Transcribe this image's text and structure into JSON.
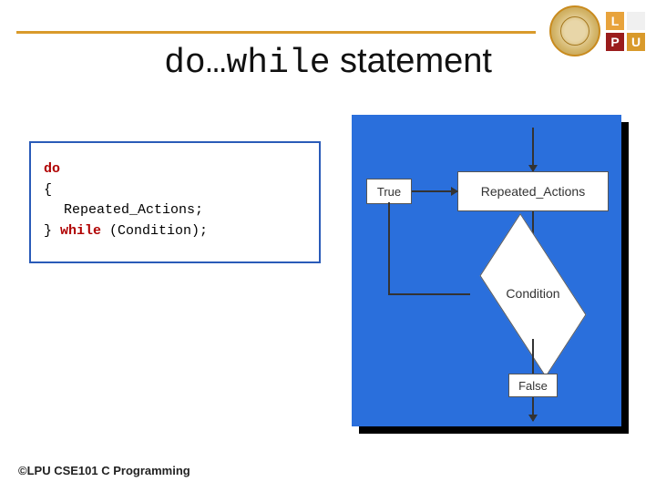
{
  "title": {
    "mono_part": "do…while",
    "rest": " statement"
  },
  "code": {
    "kw_do": "do",
    "brace_open": "{",
    "body": "Repeated_Actions;",
    "brace_close_prefix": "} ",
    "kw_while": "while",
    "while_suffix": " (Condition);"
  },
  "flowchart": {
    "process": "Repeated_Actions",
    "condition": "Condition",
    "true_label": "True",
    "false_label": "False"
  },
  "footer": "©LPU CSE101 C Programming",
  "logo": {
    "L": "L",
    "P": "P",
    "U": "U"
  }
}
